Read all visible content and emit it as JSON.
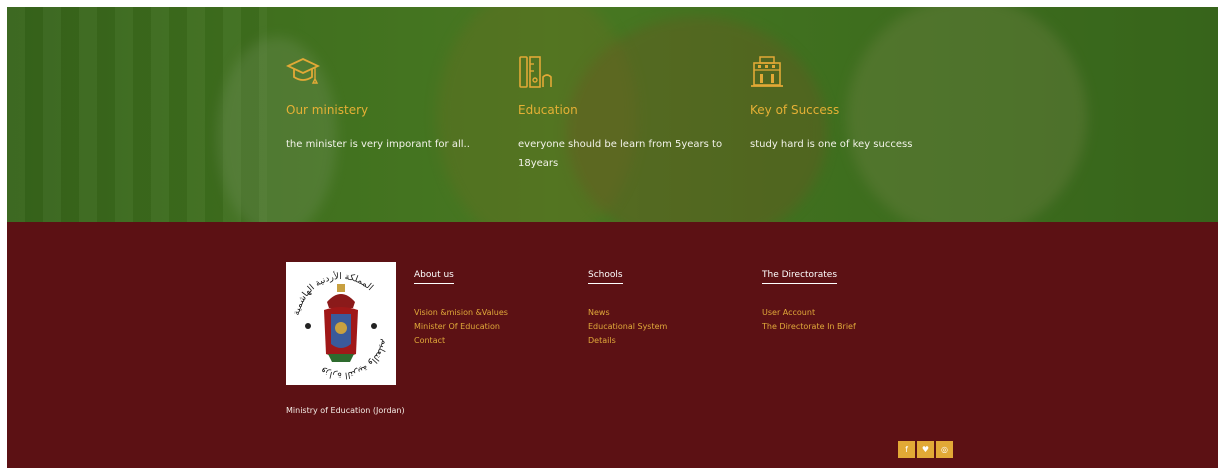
{
  "features": [
    {
      "icon": "graduation-cap-icon",
      "title": "Our ministery",
      "desc": "the minister is very imporant for all.."
    },
    {
      "icon": "pencil-ruler-icon",
      "title": "Education",
      "desc": "everyone should be learn from 5years to 18years"
    },
    {
      "icon": "building-icon",
      "title": "Key of Success",
      "desc": "study hard is one of key success"
    }
  ],
  "footer": {
    "brand": "Ministry of Education (Jordan)",
    "logo_text": "المملكة الأردنية الهاشمية · وزارة التربية والتعليم",
    "columns": [
      {
        "heading": "About us",
        "links": [
          "Vision &mision &Values",
          "Minister Of Education",
          "Contact"
        ]
      },
      {
        "heading": "Schools",
        "links": [
          "News",
          "Educational System",
          "Details"
        ]
      },
      {
        "heading": "The Directorates",
        "links": [
          "User Account",
          "The Directorate In Brief"
        ]
      }
    ],
    "social": [
      {
        "icon": "facebook-icon",
        "glyph": "f"
      },
      {
        "icon": "twitter-icon",
        "glyph": "♥"
      },
      {
        "icon": "instagram-icon",
        "glyph": "◎"
      }
    ]
  },
  "colors": {
    "accent": "#e2a936",
    "footer_bg": "#5c1114",
    "hero_green": "#4b7a23"
  }
}
